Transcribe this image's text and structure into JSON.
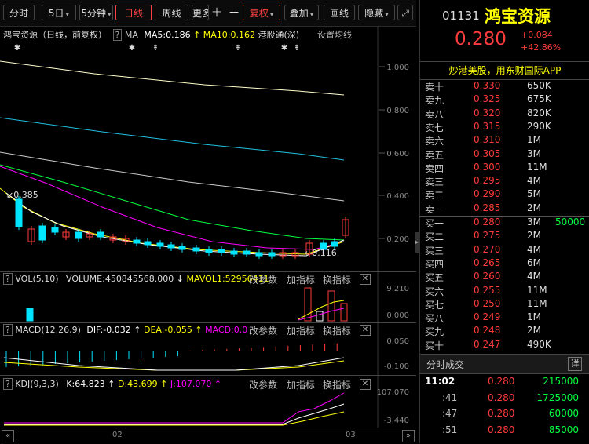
{
  "toolbar": {
    "items": [
      "分时",
      "5日",
      "5分钟",
      "日线",
      "周线",
      "更多",
      "十",
      "一",
      "复权",
      "叠加",
      "画线",
      "隐藏"
    ],
    "zoom_icon": "expand-icon"
  },
  "stock": {
    "name": "鸿宝资源",
    "code": "01131",
    "price": "0.280",
    "change": "+0.084",
    "change_pct": "+42.86%",
    "ad_text": "炒港美股，用东财国际APP"
  },
  "main_chart": {
    "info_name": "鸿宝资源（日线，前复权）",
    "help": "?",
    "ma_label": "MA",
    "ma5": "MA5:0.186",
    "ma10": "MA10:0.162",
    "connect": "港股通(深)",
    "settings": "设置均线",
    "y_labels": [
      "1.000",
      "0.800",
      "0.600",
      "0.400",
      "0.200"
    ],
    "high_label": "0.385",
    "low_label": "0.116"
  },
  "vol_panel": {
    "label": "VOL(5,10)",
    "volume": "VOLUME:450845568.000",
    "mavol1": "MAVOL1:52956411",
    "change_param": "改参数",
    "add_indicator": "加指标",
    "switch_indicator": "换指标",
    "y_labels": [
      "9.210",
      "0.000"
    ]
  },
  "macd_panel": {
    "label": "MACD(12,26,9)",
    "dif": "DIF:-0.032",
    "dea": "DEA:-0.055",
    "macd": "MACD:0.0",
    "change_param": "改参数",
    "add_indicator": "加指标",
    "switch_indicator": "换指标",
    "y_labels": [
      "0.050",
      "-0.100"
    ]
  },
  "kdj_panel": {
    "label": "KDJ(9,3,3)",
    "k": "K:64.823",
    "d": "D:43.699",
    "j": "J:107.070",
    "change_param": "改参数",
    "add_indicator": "加指标",
    "switch_indicator": "换指标",
    "y_labels": [
      "107.070",
      "-3.440"
    ]
  },
  "x_axis": [
    "02",
    "03"
  ],
  "sell_orders": [
    {
      "label": "卖十",
      "price": "0.330",
      "vol": "650K"
    },
    {
      "label": "卖九",
      "price": "0.325",
      "vol": "675K"
    },
    {
      "label": "卖八",
      "price": "0.320",
      "vol": "820K"
    },
    {
      "label": "卖七",
      "price": "0.315",
      "vol": "290K"
    },
    {
      "label": "卖六",
      "price": "0.310",
      "vol": "1M"
    },
    {
      "label": "卖五",
      "price": "0.305",
      "vol": "3M"
    },
    {
      "label": "卖四",
      "price": "0.300",
      "vol": "11M"
    },
    {
      "label": "卖三",
      "price": "0.295",
      "vol": "4M"
    },
    {
      "label": "卖二",
      "price": "0.290",
      "vol": "5M"
    },
    {
      "label": "卖一",
      "price": "0.285",
      "vol": "2M"
    }
  ],
  "buy_orders": [
    {
      "label": "买一",
      "price": "0.280",
      "vol": "3M",
      "extra": "50000"
    },
    {
      "label": "买二",
      "price": "0.275",
      "vol": "2M",
      "extra": ""
    },
    {
      "label": "买三",
      "price": "0.270",
      "vol": "4M",
      "extra": ""
    },
    {
      "label": "买四",
      "price": "0.265",
      "vol": "6M",
      "extra": ""
    },
    {
      "label": "买五",
      "price": "0.260",
      "vol": "4M",
      "extra": ""
    },
    {
      "label": "买六",
      "price": "0.255",
      "vol": "11M",
      "extra": ""
    },
    {
      "label": "买七",
      "price": "0.250",
      "vol": "11M",
      "extra": ""
    },
    {
      "label": "买八",
      "price": "0.249",
      "vol": "1M",
      "extra": ""
    },
    {
      "label": "买九",
      "price": "0.248",
      "vol": "2M",
      "extra": ""
    },
    {
      "label": "买十",
      "price": "0.247",
      "vol": "490K",
      "extra": ""
    }
  ],
  "ticks_panel": {
    "title": "分时成交",
    "detail": "详",
    "rows": [
      {
        "time": "11:02",
        "price": "0.280",
        "vol": "215000"
      },
      {
        "time": ":41",
        "price": "0.280",
        "vol": "1725000"
      },
      {
        "time": ":47",
        "price": "0.280",
        "vol": "60000"
      },
      {
        "time": ":51",
        "price": "0.280",
        "vol": "85000"
      }
    ]
  },
  "colors": {
    "up": "#ff3b3b",
    "down": "#00e5ff",
    "yellow": "#ffff00",
    "magenta": "#ff00ff",
    "green": "#00ff40",
    "white": "#ffffff"
  }
}
